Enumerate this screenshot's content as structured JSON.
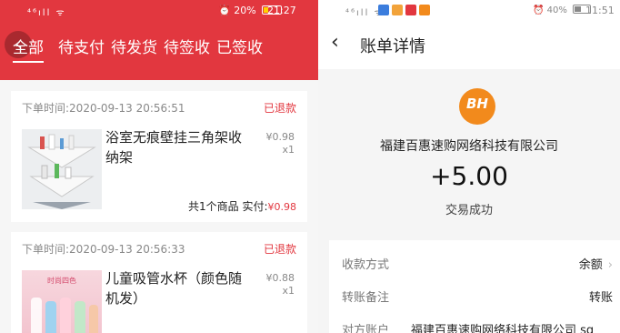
{
  "left": {
    "status": {
      "signal": "⁴⁶ıll ᯤ",
      "battery": "20%",
      "time": "21:27"
    },
    "tabs": [
      "全部",
      "待支付",
      "待发货",
      "待签收",
      "已签收"
    ],
    "orders": [
      {
        "time": "下单时间:2020-09-13 20:56:51",
        "status": "已退款",
        "name": "浴室无痕壁挂三角架收纳架",
        "price": "¥0.98",
        "qty": "x1",
        "summary_prefix": "共1个商品 实付:",
        "summary_amount": "¥0.98"
      },
      {
        "time": "下单时间:2020-09-13 20:56:33",
        "status": "已退款",
        "name": "儿童吸管水杯（颜色随机发）",
        "price": "¥0.88",
        "qty": "x1",
        "thumb_text": "时尚四色"
      }
    ]
  },
  "right": {
    "status": {
      "signal": "⁴⁶ıll ᯤ",
      "battery": "40%",
      "time": "11:51"
    },
    "nav_title": "账单详情",
    "logo_text": "BH",
    "merchant": "福建百惠速购网络科技有限公司",
    "amount": "+5.00",
    "tx_status": "交易成功",
    "rows": [
      {
        "label": "收款方式",
        "value": "余额"
      },
      {
        "label": "转账备注",
        "value": "转账"
      },
      {
        "label": "对方账户",
        "value": "福建百惠速购网络科技有限公司 sg"
      }
    ]
  },
  "colors": {
    "brand_red": "#e2373f",
    "logo_orange": "#f28a1c"
  },
  "icons": [
    "back-icon",
    "chevron-right-icon",
    "battery-icon",
    "alarm-icon",
    "wifi-icon",
    "signal-icon"
  ]
}
